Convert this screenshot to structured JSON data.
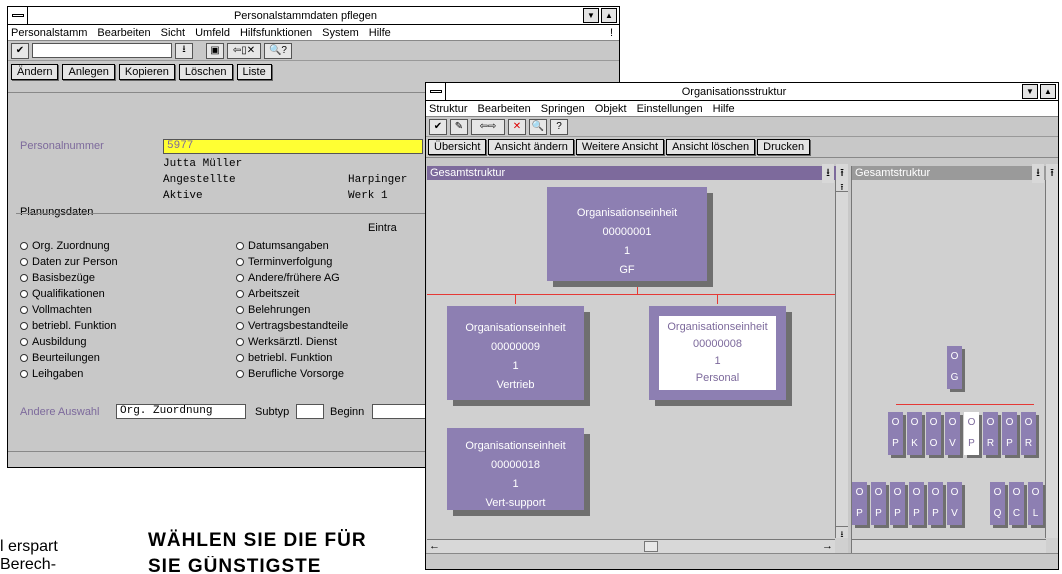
{
  "win1": {
    "title": "Personalstammdaten pflegen",
    "menu": [
      "Personalstamm",
      "Bearbeiten",
      "Sicht",
      "Umfeld",
      "Hilfsfunktionen",
      "System",
      "Hilfe"
    ],
    "menu_end": "!",
    "buttons": [
      "Ändern",
      "Anlegen",
      "Kopieren",
      "Löschen",
      "Liste"
    ],
    "pn_label": "Personalnummer",
    "pn_value": "5977",
    "name": "Jutta Müller",
    "type": "Angestellte",
    "status": "Aktive",
    "city": "Harpinger",
    "site": "Werk 1",
    "section": "Planungsdaten",
    "eintrag": "Eintra",
    "left_options": [
      "Org. Zuordnung",
      "Daten zur Person",
      "Basisbezüge",
      "Qualifikationen",
      "Vollmachten",
      "betriebl. Funktion",
      "Ausbildung",
      "Beurteilungen",
      "Leihgaben"
    ],
    "right_options": [
      "Datumsangaben",
      "Terminverfolgung",
      "Andere/frühere AG",
      "Arbeitszeit",
      "Belehrungen",
      "Vertragsbestandteile",
      "Werksärztl. Dienst",
      "betriebl. Funktion",
      "Berufliche Vorsorge"
    ],
    "andere_label": "Andere Auswahl",
    "andere_value": "Org. Zuordnung",
    "subtyp": "Subtyp",
    "beginn": "Beginn"
  },
  "win2": {
    "title": "Organisationsstruktur",
    "menu": [
      "Struktur",
      "Bearbeiten",
      "Springen",
      "Objekt",
      "Einstellungen",
      "Hilfe"
    ],
    "buttons": [
      "Übersicht",
      "Ansicht ändern",
      "Weitere Ansicht",
      "Ansicht löschen",
      "Drucken"
    ],
    "pane_left": "Gesamtstruktur",
    "pane_right": "Gesamtstruktur",
    "units": [
      {
        "l1": "Organisationseinheit",
        "l2": "00000001",
        "l3": "1",
        "l4": "GF"
      },
      {
        "l1": "Organisationseinheit",
        "l2": "00000009",
        "l3": "1",
        "l4": "Vertrieb"
      },
      {
        "l1": "Organisationseinheit",
        "l2": "00000008",
        "l3": "1",
        "l4": "Personal"
      },
      {
        "l1": "Organisationseinheit",
        "l2": "00000018",
        "l3": "1",
        "l4": "Vert-support"
      }
    ],
    "mini_top": {
      "a": "O",
      "b": "G"
    },
    "mini_row1": [
      [
        "O",
        "P"
      ],
      [
        "O",
        "K"
      ],
      [
        "O",
        "O"
      ],
      [
        "O",
        "V"
      ],
      [
        "O",
        "P"
      ],
      [
        "O",
        "R"
      ],
      [
        "O",
        "P"
      ],
      [
        "O",
        "R"
      ]
    ],
    "mini_row2": [
      [
        "O",
        "P"
      ],
      [
        "O",
        "P"
      ],
      [
        "O",
        "P"
      ],
      [
        "O",
        "P"
      ],
      [
        "O",
        "P"
      ],
      [
        "O",
        "V"
      ]
    ],
    "mini_row3": [
      [
        "O",
        "Q"
      ],
      [
        "O",
        "C"
      ],
      [
        "O",
        "L"
      ]
    ]
  },
  "page_text": {
    "left1": "l erspart",
    "left2": "Berech-",
    "heading1": "WÄHLEN SIE DIE FÜR",
    "heading2": "SIE GÜNSTIGSTE"
  },
  "colors": {
    "accent": "#7d6a9c",
    "box": "#8d7fb2",
    "highlight": "#ffff33",
    "line": "#e53935"
  }
}
